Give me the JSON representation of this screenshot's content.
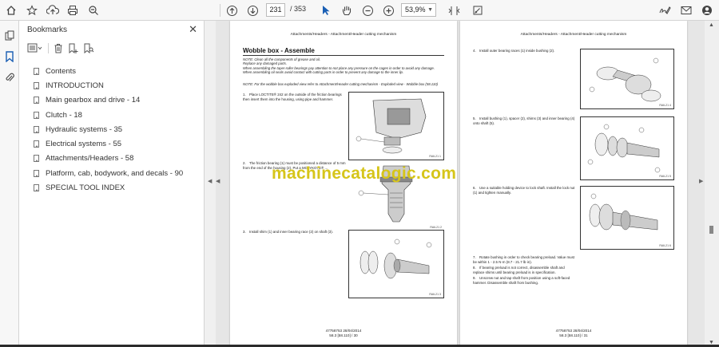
{
  "toolbar": {
    "page_current": "231",
    "page_total": "/ 353",
    "zoom": "53,9%"
  },
  "icons": [
    "home-icon",
    "star-icon",
    "upload-icon",
    "print-icon",
    "zoom-out-search-icon",
    "prev-page-icon",
    "next-page-icon",
    "select-arrow-icon",
    "hand-icon",
    "zoom-out-icon",
    "zoom-in-icon",
    "fit-icon",
    "annotate-icon",
    "sign-icon",
    "email-icon",
    "account-icon"
  ],
  "panel": {
    "title": "Bookmarks",
    "close": "✕",
    "bookmarks": [
      "Contents",
      "INTRODUCTION",
      "Main gearbox and drive - 14",
      "Clutch - 18",
      "Hydraulic systems - 35",
      "Electrical systems - 55",
      "Attachments/Headers - 58",
      "Platform, cab, bodywork, and decals - 90",
      "SPECIAL TOOL INDEX"
    ]
  },
  "page_left": {
    "header": "Attachments/Headers - Attachment/Header cutting mechanism",
    "section_title": "Wobble box - Assemble",
    "note1_a": "NOTE: Clean all the components of grease and oil.",
    "note1_b": "Replace any damaged parts.",
    "note1_c": "When assembling the taper-roller bearings pay attention to not place any pressure on the cages in order to avoid any damage.",
    "note1_d": "When assembling oil seals avoid contact with cutting parts in order to prevent any damage to the inner lip.",
    "note2": "NOTE: For the wobble box exploded view refer to Attachment/Header cutting mechanism - Exploded view - Wobble box (58.110)",
    "step1": "Place LOCTITE® 242 on the outside of the friction bearings then insert them into the housing, using pipe and hammer.",
    "step2": "The friction bearing (1) must be positioned a distance of 5 mm from the end of the housing (2). Put a MOLYKOTE® ...",
    "step3": "Install shim (1) and inner bearing race (2) on shaft (3).",
    "fig1_ref": "RAIL21 1",
    "fig2_ref": "RAIL21 2",
    "fig3_ref": "RAIL21 3",
    "footer1": "47758753 28/04/2014",
    "footer2": "58.3 [58.110] / 30"
  },
  "page_right": {
    "header": "Attachments/Headers - Attachment/Header cutting mechanism",
    "step4": "Install outer bearing races (1) inside bushing (2).",
    "step5": "Install bushing (1), spacer (2), shims (3) and inner bearing (4) onto shaft (5).",
    "step6": "Use a suitable holding device to lock shaft. Install the lock nut (1) and tighten manually.",
    "step7": "Rotate bushing in order to check bearing preload. Value must be within 1 - 2.5 N·m (8.7 - 21.7 lb·in).",
    "step8": "If bearing preload is not correct, disassemble shaft and replace shims until bearing preload is in specification.",
    "step9": "Unscrew nut and tap shaft from position using a soft-faced hammer. Disassemble shaft from bushing.",
    "fig4_ref": "RAIL21 4",
    "fig5_ref": "RAIL21 5",
    "fig6_ref": "RAIL21 6",
    "footer1": "47758753 28/04/2014",
    "footer2": "58.3 [58.110] / 31"
  },
  "watermark": "machinecatalogic.com"
}
